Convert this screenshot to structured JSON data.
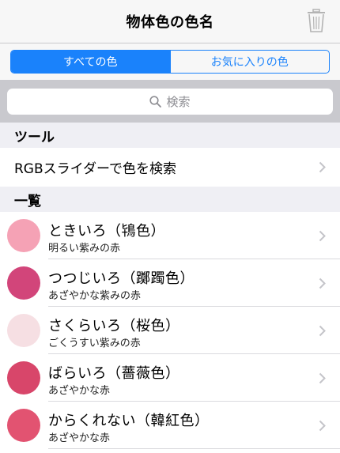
{
  "nav": {
    "title": "物体色の色名",
    "trash_icon": "trash-icon"
  },
  "segments": [
    {
      "label": "すべての色",
      "active": true
    },
    {
      "label": "お気に入りの色",
      "active": false
    }
  ],
  "search": {
    "placeholder": "検索",
    "icon": "search-icon"
  },
  "sections": {
    "tools": {
      "header": "ツール",
      "items": [
        {
          "label": "RGBスライダーで色を検索"
        }
      ]
    },
    "list": {
      "header": "一覧",
      "items": [
        {
          "name": "ときいろ（鴇色）",
          "desc": "明るい紫みの赤",
          "color": "#f5a2b5"
        },
        {
          "name": "つつじいろ（躑躅色）",
          "desc": "あざやかな紫みの赤",
          "color": "#d2457a"
        },
        {
          "name": "さくらいろ（桜色）",
          "desc": "ごくうすい紫みの赤",
          "color": "#f6dfe3"
        },
        {
          "name": "ばらいろ（薔薇色）",
          "desc": "あざやかな赤",
          "color": "#d8466a"
        },
        {
          "name": "からくれない（韓紅色）",
          "desc": "あざやかな赤",
          "color": "#e25371"
        }
      ]
    }
  },
  "colors": {
    "accent": "#1a82fb",
    "section_bg": "#efeff4",
    "search_bg": "#c9c9ce"
  }
}
